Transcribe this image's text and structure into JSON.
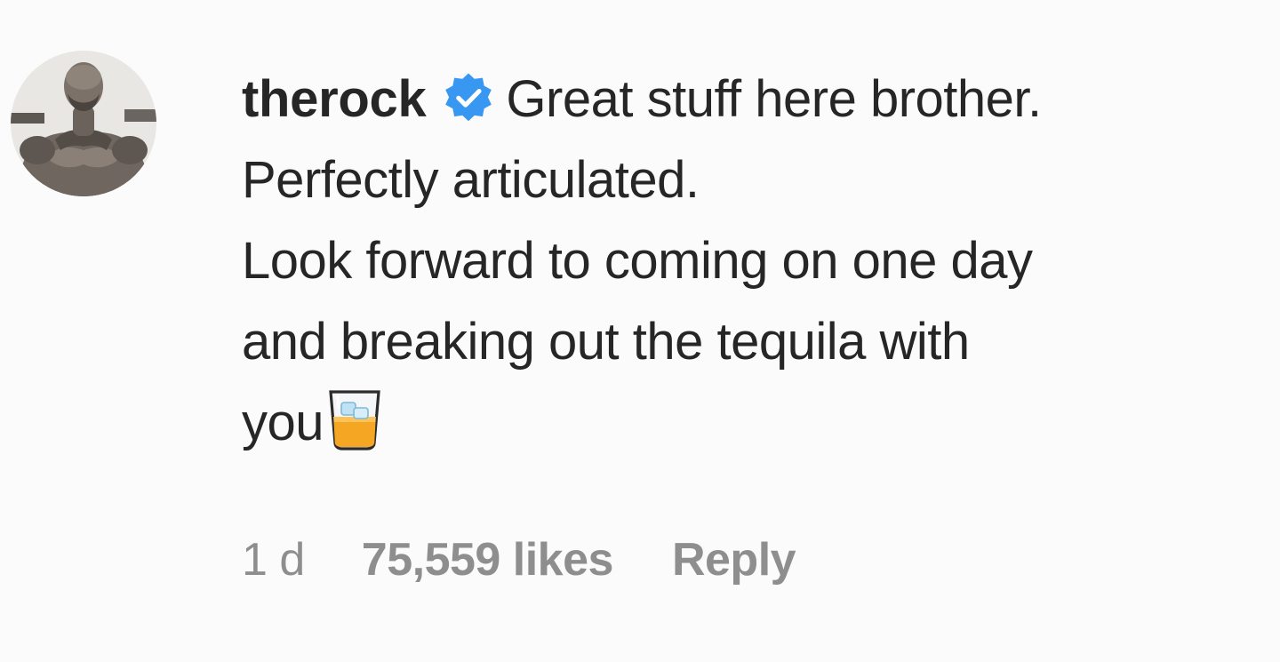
{
  "comment": {
    "username": "therock",
    "text_lines": [
      "Great stuff here brother.",
      "Perfectly articulated.",
      "Look forward to coming on one day",
      "and breaking out the tequila with",
      "you"
    ],
    "emoji": "tumbler-glass-emoji",
    "time": "1 d",
    "likes": "75,559 likes",
    "reply_label": "Reply",
    "verified_color": "#3897f0"
  }
}
